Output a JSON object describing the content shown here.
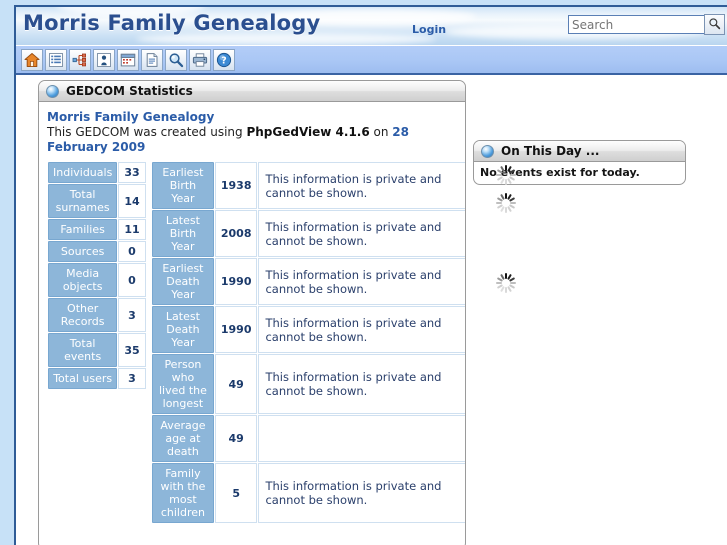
{
  "header": {
    "site_title": "Morris Family Genealogy",
    "login_label": "Login",
    "search_placeholder": "Search",
    "search_value": "",
    "search_icon": "magnifier-icon"
  },
  "toolbar": {
    "buttons": [
      {
        "name": "home",
        "icon": "home-icon",
        "title": "Home page"
      },
      {
        "name": "lists",
        "icon": "list-icon",
        "title": "Lists"
      },
      {
        "name": "charts",
        "icon": "tree-chart-icon",
        "title": "Charts"
      },
      {
        "name": "individual",
        "icon": "person-icon",
        "title": "Individual"
      },
      {
        "name": "calendar",
        "icon": "calendar-icon",
        "title": "Calendar"
      },
      {
        "name": "reports",
        "icon": "document-icon",
        "title": "Reports"
      },
      {
        "name": "search",
        "icon": "magnifier-icon",
        "title": "Search"
      },
      {
        "name": "print",
        "icon": "printer-icon",
        "title": "Print"
      },
      {
        "name": "help",
        "icon": "help-icon",
        "title": "Help"
      }
    ]
  },
  "stats_panel": {
    "title": "GEDCOM Statistics",
    "icon": "blue-orb-icon",
    "gedcom_name": "Morris Family Genealogy",
    "created_prefix": "This GEDCOM was created using ",
    "software": "PhpGedView 4.1.6",
    "created_middle": " on ",
    "created_date": "28 February 2009",
    "left_table": [
      {
        "label": "Individuals",
        "value": "33"
      },
      {
        "label": "Total surnames",
        "value": "14"
      },
      {
        "label": "Families",
        "value": "11"
      },
      {
        "label": "Sources",
        "value": "0"
      },
      {
        "label": "Media objects",
        "value": "0"
      },
      {
        "label": "Other Records",
        "value": "3"
      },
      {
        "label": "Total events",
        "value": "35"
      },
      {
        "label": "Total users",
        "value": "3"
      }
    ],
    "private_note": "This information is private and cannot be shown.",
    "right_table": [
      {
        "label": "Earliest Birth Year",
        "value": "1938",
        "note": "This information is private and cannot be shown."
      },
      {
        "label": "Latest Birth Year",
        "value": "2008",
        "note": "This information is private and cannot be shown."
      },
      {
        "label": "Earliest Death Year",
        "value": "1990",
        "note": "This information is private and cannot be shown."
      },
      {
        "label": "Latest Death Year",
        "value": "1990",
        "note": "This information is private and cannot be shown."
      },
      {
        "label": "Person who lived the longest",
        "value": "49",
        "note": "This information is private and cannot be shown."
      },
      {
        "label": "Average age at death",
        "value": "49",
        "note": ""
      },
      {
        "label": "Family with the most children",
        "value": "5",
        "note": "This information is private and cannot be shown."
      }
    ]
  },
  "on_this_day": {
    "title": "On This Day ...",
    "icon": "blue-orb-icon",
    "message": "No events exist for today."
  },
  "loading": {
    "spinner_count": 3,
    "icon": "loading-spinner-icon"
  },
  "colors": {
    "page_background": "#c7e1f7",
    "frame_border": "#2f5c97",
    "title_text": "#2b4f8f",
    "link_blue": "#2b5ca8",
    "label_cell": "#8db6d9",
    "value_text": "#1b3a6b",
    "toolbar_background": "#aac7f5"
  }
}
